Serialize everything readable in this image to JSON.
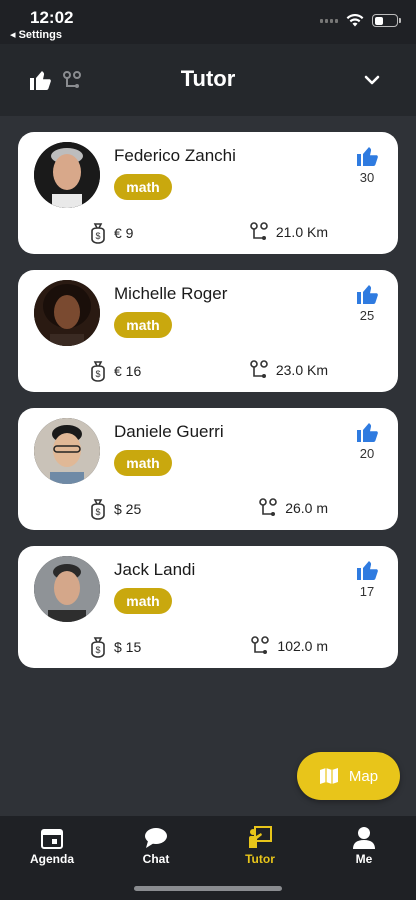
{
  "status_bar": {
    "time": "12:02",
    "back_label": "◂ Settings"
  },
  "header": {
    "title": "Tutor"
  },
  "colors": {
    "accent": "#e8c51a",
    "subject_badge": "#c9a80e",
    "like_blue": "#2f7be0",
    "background": "#2f3237"
  },
  "tutors": [
    {
      "name": "Federico Zanchi",
      "subject": "math",
      "likes": "30",
      "price": "€ 9",
      "distance": "21.0 Km"
    },
    {
      "name": "Michelle Roger",
      "subject": "math",
      "likes": "25",
      "price": "€ 16",
      "distance": "23.0 Km"
    },
    {
      "name": "Daniele Guerri",
      "subject": "math",
      "likes": "20",
      "price": "$ 25",
      "distance": "26.0 m"
    },
    {
      "name": "Jack Landi",
      "subject": "math",
      "likes": "17",
      "price": "$ 15",
      "distance": "102.0 m"
    }
  ],
  "map_button": {
    "label": "Map"
  },
  "tabs": [
    {
      "label": "Agenda",
      "icon": "calendar-icon"
    },
    {
      "label": "Chat",
      "icon": "chat-bubble-icon"
    },
    {
      "label": "Tutor",
      "icon": "teacher-icon",
      "active": true
    },
    {
      "label": "Me",
      "icon": "person-icon"
    }
  ]
}
